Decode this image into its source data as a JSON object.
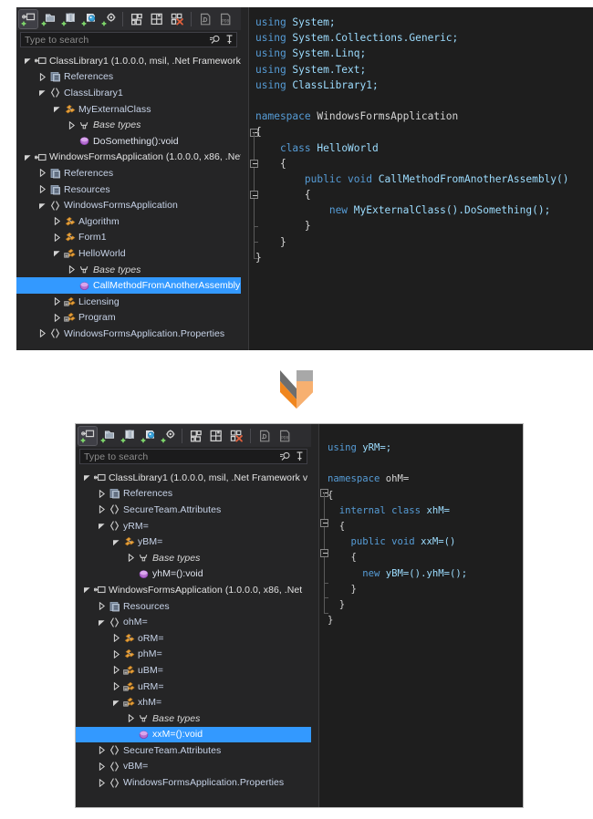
{
  "meta": {
    "accent_selection": "#3399ff",
    "panel_bg": "#1e1e1e",
    "explorer_bg": "#252526",
    "toolbar_bg": "#2d2d30"
  },
  "toolbar": {
    "buttons": [
      {
        "name": "add-assembly-icon",
        "tooltip": "Open"
      },
      {
        "name": "add-folder-icon",
        "tooltip": "Open folder"
      },
      {
        "name": "add-list-icon",
        "tooltip": "Open list"
      },
      {
        "name": "add-search-icon",
        "tooltip": "Search assembly"
      },
      {
        "name": "add-settings-icon",
        "tooltip": "Options"
      },
      {
        "name": "build-icon",
        "tooltip": "Build"
      },
      {
        "name": "save-all-icon",
        "tooltip": "Save all"
      },
      {
        "name": "clear-icon",
        "tooltip": "Clear list"
      },
      {
        "name": "copy-il-icon",
        "tooltip": "Copy IL"
      },
      {
        "name": "pdb-icon",
        "tooltip": "Load PDB"
      }
    ],
    "separator_after": [
      4,
      7
    ]
  },
  "search": {
    "placeholder": "Type to search",
    "search_icon": "search-icon",
    "pin_icon": "pin-icon"
  },
  "panels": [
    {
      "id": "original",
      "tree": [
        {
          "depth": 0,
          "twisty": "expanded",
          "icon": "assembly-icon",
          "label": "ClassLibrary1 (1.0.0.0, msil, .Net Framework v",
          "style": "asm"
        },
        {
          "depth": 1,
          "twisty": "collapsed",
          "icon": "references-icon",
          "label": "References",
          "style": "ref"
        },
        {
          "depth": 1,
          "twisty": "expanded",
          "icon": "namespace-icon",
          "label": "ClassLibrary1",
          "style": "ns"
        },
        {
          "depth": 2,
          "twisty": "expanded",
          "icon": "class-public-icon",
          "label": "MyExternalClass",
          "style": "type"
        },
        {
          "depth": 3,
          "twisty": "collapsed",
          "icon": "base-types-icon",
          "label": "Base types",
          "style": "base"
        },
        {
          "depth": 3,
          "twisty": "none",
          "icon": "method-icon",
          "label": "DoSomething():void",
          "style": "mem"
        },
        {
          "depth": 0,
          "twisty": "expanded",
          "icon": "assembly-icon",
          "label": "WindowsFormsApplication (1.0.0.0, x86, .Net",
          "style": "asm"
        },
        {
          "depth": 1,
          "twisty": "collapsed",
          "icon": "references-icon",
          "label": "References",
          "style": "ref"
        },
        {
          "depth": 1,
          "twisty": "collapsed",
          "icon": "references-icon",
          "label": "Resources",
          "style": "ref"
        },
        {
          "depth": 1,
          "twisty": "expanded",
          "icon": "namespace-icon",
          "label": "WindowsFormsApplication",
          "style": "ns"
        },
        {
          "depth": 2,
          "twisty": "collapsed",
          "icon": "class-public-icon",
          "label": "Algorithm",
          "style": "type"
        },
        {
          "depth": 2,
          "twisty": "collapsed",
          "icon": "class-public-icon",
          "label": "Form1",
          "style": "type"
        },
        {
          "depth": 2,
          "twisty": "expanded",
          "icon": "class-internal-icon",
          "label": "HelloWorld",
          "style": "type"
        },
        {
          "depth": 3,
          "twisty": "collapsed",
          "icon": "base-types-icon",
          "label": "Base types",
          "style": "base"
        },
        {
          "depth": 3,
          "twisty": "none",
          "icon": "method-icon",
          "label": "CallMethodFromAnotherAssembly(",
          "style": "mem",
          "selected": true
        },
        {
          "depth": 2,
          "twisty": "collapsed",
          "icon": "class-internal-icon",
          "label": "Licensing",
          "style": "type"
        },
        {
          "depth": 2,
          "twisty": "collapsed",
          "icon": "class-internal-icon",
          "label": "Program",
          "style": "type"
        },
        {
          "depth": 1,
          "twisty": "collapsed",
          "icon": "namespace-icon",
          "label": "WindowsFormsApplication.Properties",
          "style": "ns"
        }
      ],
      "code_lines": [
        [
          {
            "t": "using ",
            "c": "k"
          },
          {
            "t": "System;",
            "c": "id"
          }
        ],
        [
          {
            "t": "using ",
            "c": "k"
          },
          {
            "t": "System.Collections.Generic;",
            "c": "id"
          }
        ],
        [
          {
            "t": "using ",
            "c": "k"
          },
          {
            "t": "System.Linq;",
            "c": "id"
          }
        ],
        [
          {
            "t": "using ",
            "c": "k"
          },
          {
            "t": "System.Text;",
            "c": "id"
          }
        ],
        [
          {
            "t": "using ",
            "c": "k"
          },
          {
            "t": "ClassLibrary1;",
            "c": "id"
          }
        ],
        [
          {
            "t": "",
            "c": "p"
          }
        ],
        [
          {
            "t": "namespace ",
            "c": "k"
          },
          {
            "t": "WindowsFormsApplication",
            "c": "ns2"
          }
        ],
        [
          {
            "t": "{",
            "c": "p"
          }
        ],
        [
          {
            "t": "    ",
            "c": "p"
          },
          {
            "t": "class ",
            "c": "k"
          },
          {
            "t": "HelloWorld",
            "c": "id"
          }
        ],
        [
          {
            "t": "    {",
            "c": "p"
          }
        ],
        [
          {
            "t": "        ",
            "c": "p"
          },
          {
            "t": "public void ",
            "c": "k"
          },
          {
            "t": "CallMethodFromAnotherAssembly()",
            "c": "id"
          }
        ],
        [
          {
            "t": "        {",
            "c": "p"
          }
        ],
        [
          {
            "t": "            ",
            "c": "p"
          },
          {
            "t": "new ",
            "c": "k"
          },
          {
            "t": "MyExternalClass().DoSomething();",
            "c": "id"
          }
        ],
        [
          {
            "t": "        }",
            "c": "p"
          }
        ],
        [
          {
            "t": "    }",
            "c": "p"
          }
        ],
        [
          {
            "t": "}",
            "c": "p"
          }
        ]
      ]
    },
    {
      "id": "obfuscated",
      "tree": [
        {
          "depth": 0,
          "twisty": "expanded",
          "icon": "assembly-icon",
          "label": "ClassLibrary1 (1.0.0.0, msil, .Net Framework v",
          "style": "asm"
        },
        {
          "depth": 1,
          "twisty": "collapsed",
          "icon": "references-icon",
          "label": "References",
          "style": "ref"
        },
        {
          "depth": 1,
          "twisty": "collapsed",
          "icon": "namespace-icon",
          "label": "SecureTeam.Attributes",
          "style": "ns"
        },
        {
          "depth": 1,
          "twisty": "expanded",
          "icon": "namespace-icon",
          "label": "yRM=",
          "style": "ns"
        },
        {
          "depth": 2,
          "twisty": "expanded",
          "icon": "class-public-icon",
          "label": "yBM=",
          "style": "type"
        },
        {
          "depth": 3,
          "twisty": "collapsed",
          "icon": "base-types-icon",
          "label": "Base types",
          "style": "base"
        },
        {
          "depth": 3,
          "twisty": "none",
          "icon": "method-icon",
          "label": "yhM=():void",
          "style": "mem"
        },
        {
          "depth": 0,
          "twisty": "expanded",
          "icon": "assembly-icon",
          "label": "WindowsFormsApplication (1.0.0.0, x86, .Net",
          "style": "asm"
        },
        {
          "depth": 1,
          "twisty": "collapsed",
          "icon": "references-icon",
          "label": "Resources",
          "style": "ref"
        },
        {
          "depth": 1,
          "twisty": "expanded",
          "icon": "namespace-icon",
          "label": "ohM=",
          "style": "ns"
        },
        {
          "depth": 2,
          "twisty": "collapsed",
          "icon": "class-public-icon",
          "label": "oRM=",
          "style": "type"
        },
        {
          "depth": 2,
          "twisty": "collapsed",
          "icon": "class-public-icon",
          "label": "phM=",
          "style": "type"
        },
        {
          "depth": 2,
          "twisty": "collapsed",
          "icon": "class-internal-icon",
          "label": "uBM=",
          "style": "type"
        },
        {
          "depth": 2,
          "twisty": "collapsed",
          "icon": "class-internal-icon",
          "label": "uRM=",
          "style": "type"
        },
        {
          "depth": 2,
          "twisty": "expanded",
          "icon": "class-internal-icon",
          "label": "xhM=",
          "style": "type"
        },
        {
          "depth": 3,
          "twisty": "collapsed",
          "icon": "base-types-icon",
          "label": "Base types",
          "style": "base"
        },
        {
          "depth": 3,
          "twisty": "none",
          "icon": "method-icon",
          "label": "xxM=():void",
          "style": "mem",
          "selected": true
        },
        {
          "depth": 1,
          "twisty": "collapsed",
          "icon": "namespace-icon",
          "label": "SecureTeam.Attributes",
          "style": "ns"
        },
        {
          "depth": 1,
          "twisty": "collapsed",
          "icon": "namespace-icon",
          "label": "vBM=",
          "style": "ns"
        },
        {
          "depth": 1,
          "twisty": "collapsed",
          "icon": "namespace-icon",
          "label": "WindowsFormsApplication.Properties",
          "style": "ns"
        }
      ],
      "code_lines": [
        [
          {
            "t": "using ",
            "c": "k"
          },
          {
            "t": "yRM=;",
            "c": "id"
          }
        ],
        [
          {
            "t": "",
            "c": "p"
          }
        ],
        [
          {
            "t": "namespace ",
            "c": "k"
          },
          {
            "t": "ohM=",
            "c": "ns2"
          }
        ],
        [
          {
            "t": "{",
            "c": "p"
          }
        ],
        [
          {
            "t": "  ",
            "c": "p"
          },
          {
            "t": "internal class ",
            "c": "k"
          },
          {
            "t": "xhM=",
            "c": "id"
          }
        ],
        [
          {
            "t": "  {",
            "c": "p"
          }
        ],
        [
          {
            "t": "    ",
            "c": "p"
          },
          {
            "t": "public void ",
            "c": "k"
          },
          {
            "t": "xxM=()",
            "c": "id"
          }
        ],
        [
          {
            "t": "    {",
            "c": "p"
          }
        ],
        [
          {
            "t": "      ",
            "c": "p"
          },
          {
            "t": "new ",
            "c": "k"
          },
          {
            "t": "yBM=().yhM=();",
            "c": "id"
          }
        ],
        [
          {
            "t": "    }",
            "c": "p"
          }
        ],
        [
          {
            "t": "  }",
            "c": "p"
          }
        ],
        [
          {
            "t": "}",
            "c": "p"
          }
        ]
      ]
    }
  ],
  "arrow": {
    "name": "double-chevron-down-icon",
    "top_color": "#6e6e6e",
    "bottom_color": "#f0861e"
  }
}
